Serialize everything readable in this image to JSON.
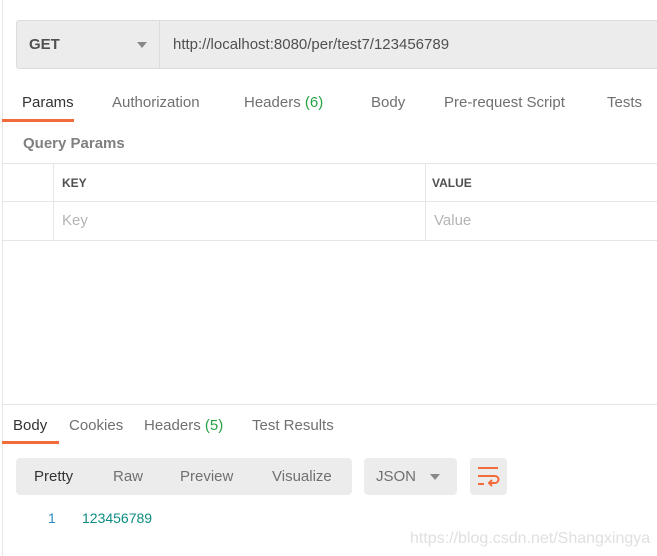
{
  "request": {
    "method": "GET",
    "url": "http://localhost:8080/per/test7/123456789"
  },
  "request_tabs": [
    {
      "label": "Params",
      "active": true
    },
    {
      "label": "Authorization"
    },
    {
      "label": "Headers",
      "count": "(6)"
    },
    {
      "label": "Body"
    },
    {
      "label": "Pre-request Script"
    },
    {
      "label": "Tests"
    }
  ],
  "query_params": {
    "title": "Query Params",
    "columns": [
      "KEY",
      "VALUE"
    ],
    "placeholders": {
      "key": "Key",
      "value": "Value"
    }
  },
  "response_tabs": [
    {
      "label": "Body",
      "active": true
    },
    {
      "label": "Cookies"
    },
    {
      "label": "Headers",
      "count": "(5)"
    },
    {
      "label": "Test Results"
    }
  ],
  "view_modes": [
    "Pretty",
    "Raw",
    "Preview",
    "Visualize"
  ],
  "format": "JSON",
  "response_body": [
    {
      "line": "1",
      "text": "123456789"
    }
  ],
  "watermark": "https://blog.csdn.net/Shangxingya",
  "colors": {
    "accent": "#f26b3a",
    "count": "#26a244",
    "code": "#0f8c82",
    "line_number": "#2a8cc4"
  }
}
